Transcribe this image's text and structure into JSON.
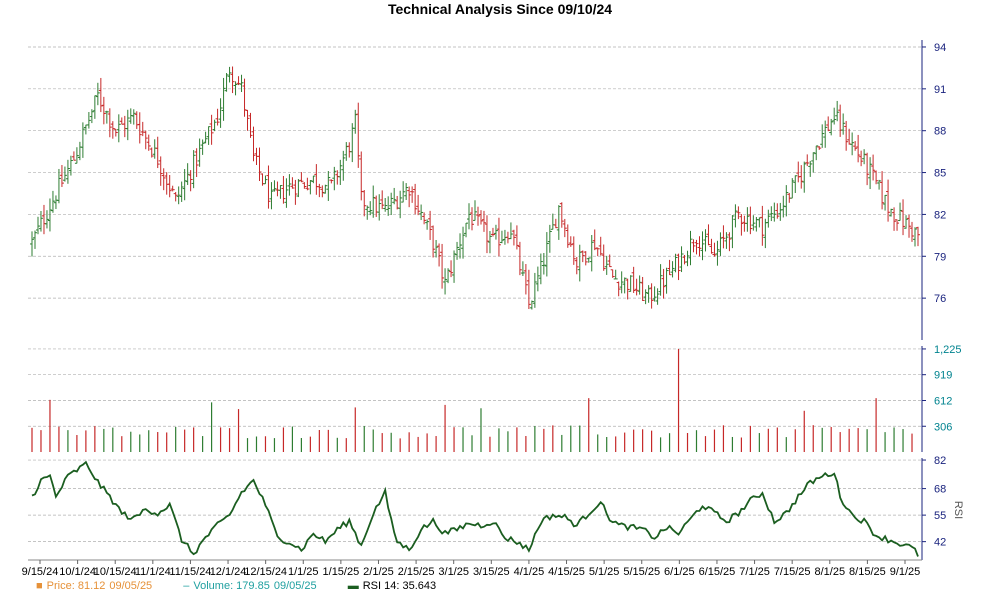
{
  "chart_data": {
    "title": "Technical Analysis Since 09/10/24",
    "type": "ohlc",
    "colors": {
      "up": "#2e7d32",
      "down": "#c62828",
      "rsi": "#1b5e20",
      "grid": "#b0b0b0",
      "axis_blue": "#1a237e",
      "volume_axis": "#00838f",
      "price_legend": "#e69138",
      "volume_legend": "#20a0a0"
    },
    "x_tick_labels": [
      "9/15/24",
      "10/1/24",
      "10/15/24",
      "11/1/24",
      "11/15/24",
      "12/1/24",
      "12/15/24",
      "1/1/25",
      "1/15/25",
      "2/1/25",
      "2/15/25",
      "3/1/25",
      "3/15/25",
      "4/1/25",
      "4/15/25",
      "5/1/25",
      "5/15/25",
      "6/1/25",
      "6/15/25",
      "7/1/25",
      "7/15/25",
      "8/1/25",
      "8/15/25",
      "9/1/25"
    ],
    "price_panel": {
      "ylim": [
        73,
        94.5
      ],
      "y_ticks": [
        76,
        79,
        82,
        85,
        88,
        91,
        94
      ],
      "anchors": [
        [
          0,
          80
        ],
        [
          8,
          83.5
        ],
        [
          14,
          86
        ],
        [
          22,
          90.5
        ],
        [
          28,
          88
        ],
        [
          34,
          89
        ],
        [
          42,
          86
        ],
        [
          48,
          83
        ],
        [
          55,
          86
        ],
        [
          62,
          89
        ],
        [
          66,
          92.5
        ],
        [
          70,
          91
        ],
        [
          74,
          86
        ],
        [
          80,
          83
        ],
        [
          86,
          84
        ],
        [
          94,
          84.5
        ],
        [
          100,
          84
        ],
        [
          106,
          87
        ],
        [
          108,
          88.5
        ],
        [
          110,
          83
        ],
        [
          118,
          82.3
        ],
        [
          126,
          84
        ],
        [
          134,
          80
        ],
        [
          138,
          77
        ],
        [
          146,
          82
        ],
        [
          154,
          80
        ],
        [
          160,
          81
        ],
        [
          166,
          75.5
        ],
        [
          170,
          78
        ],
        [
          176,
          82.5
        ],
        [
          182,
          78.5
        ],
        [
          188,
          80
        ],
        [
          194,
          77.5
        ],
        [
          200,
          77
        ],
        [
          206,
          76
        ],
        [
          214,
          78
        ],
        [
          222,
          80.5
        ],
        [
          228,
          79
        ],
        [
          236,
          82
        ],
        [
          244,
          81.2
        ],
        [
          250,
          82.5
        ],
        [
          256,
          84.5
        ],
        [
          262,
          87
        ],
        [
          268,
          89
        ],
        [
          274,
          87
        ],
        [
          280,
          85
        ],
        [
          286,
          82.5
        ],
        [
          296,
          80.5
        ]
      ],
      "anchor_count": 297
    },
    "volume_panel": {
      "ylim": [
        0,
        1260
      ],
      "y_ticks": [
        306,
        612,
        919,
        1225
      ],
      "y_tick_labels": [
        "306",
        "612",
        "919",
        "1,225"
      ],
      "typical": 290,
      "spikes": [
        [
          8,
          620
        ],
        [
          60,
          590
        ],
        [
          70,
          510
        ],
        [
          110,
          530
        ],
        [
          140,
          560
        ],
        [
          150,
          520
        ],
        [
          186,
          640
        ],
        [
          218,
          1225
        ],
        [
          282,
          640
        ],
        [
          260,
          490
        ]
      ]
    },
    "rsi_panel": {
      "ylim": [
        33,
        83
      ],
      "y_ticks": [
        42,
        55,
        68,
        82
      ],
      "anchors": [
        [
          0,
          64
        ],
        [
          3,
          72
        ],
        [
          6,
          74
        ],
        [
          8,
          64
        ],
        [
          12,
          74
        ],
        [
          16,
          78
        ],
        [
          18,
          80
        ],
        [
          20,
          76
        ],
        [
          22,
          71
        ],
        [
          26,
          64
        ],
        [
          30,
          56
        ],
        [
          34,
          53
        ],
        [
          38,
          58
        ],
        [
          42,
          56
        ],
        [
          46,
          60
        ],
        [
          50,
          43
        ],
        [
          54,
          36
        ],
        [
          58,
          44
        ],
        [
          62,
          50
        ],
        [
          66,
          55
        ],
        [
          70,
          66
        ],
        [
          74,
          72
        ],
        [
          78,
          60
        ],
        [
          82,
          44
        ],
        [
          86,
          42
        ],
        [
          90,
          38
        ],
        [
          94,
          46
        ],
        [
          98,
          42
        ],
        [
          102,
          48
        ],
        [
          106,
          52
        ],
        [
          110,
          40
        ],
        [
          114,
          56
        ],
        [
          118,
          66
        ],
        [
          120,
          52
        ],
        [
          122,
          42
        ],
        [
          126,
          38
        ],
        [
          130,
          48
        ],
        [
          134,
          52
        ],
        [
          138,
          46
        ],
        [
          142,
          48
        ],
        [
          146,
          51
        ],
        [
          150,
          50
        ],
        [
          154,
          52
        ],
        [
          158,
          44
        ],
        [
          162,
          42
        ],
        [
          166,
          38
        ],
        [
          170,
          52
        ],
        [
          174,
          55
        ],
        [
          178,
          54
        ],
        [
          182,
          50
        ],
        [
          186,
          56
        ],
        [
          190,
          62
        ],
        [
          192,
          55
        ],
        [
          196,
          50
        ],
        [
          200,
          49
        ],
        [
          204,
          48
        ],
        [
          208,
          44
        ],
        [
          212,
          49
        ],
        [
          216,
          46
        ],
        [
          220,
          53
        ],
        [
          224,
          60
        ],
        [
          228,
          56
        ],
        [
          232,
          52
        ],
        [
          236,
          56
        ],
        [
          240,
          62
        ],
        [
          244,
          66
        ],
        [
          248,
          52
        ],
        [
          252,
          56
        ],
        [
          256,
          64
        ],
        [
          260,
          71
        ],
        [
          264,
          74
        ],
        [
          268,
          76
        ],
        [
          270,
          64
        ],
        [
          274,
          55
        ],
        [
          278,
          52
        ],
        [
          282,
          45
        ],
        [
          286,
          43
        ],
        [
          290,
          41
        ],
        [
          294,
          39
        ],
        [
          296,
          35.6
        ]
      ]
    },
    "legend": {
      "price_label": "Price: 81.12",
      "price_date": "09/05/25",
      "volume_label": "Volume: 179.85",
      "volume_date": "09/05/25",
      "rsi_label": "RSI 14: 35.643"
    },
    "rsi_axis_label": "RSI"
  }
}
